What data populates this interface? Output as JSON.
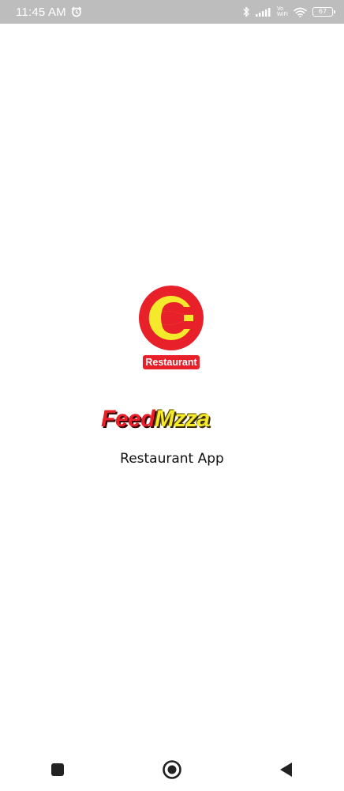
{
  "status_bar": {
    "time": "11:45 AM",
    "network_label_top": "Vo",
    "network_label_bottom": "WiFi",
    "battery_level": "67",
    "icons": [
      "alarm-icon",
      "bluetooth-icon",
      "signal-icon",
      "vowifi-icon",
      "wifi-icon",
      "battery-icon"
    ]
  },
  "logo": {
    "badge_label": "Restaurant",
    "colors": {
      "red": "#e8202a",
      "yellow": "#f4ea2b"
    }
  },
  "brand": {
    "part_1": "Feed",
    "part_2": "Mzza"
  },
  "subtitle": "Restaurant App",
  "nav_bar": {
    "icons": [
      "recents-square-icon",
      "home-circle-icon",
      "back-triangle-icon"
    ]
  }
}
